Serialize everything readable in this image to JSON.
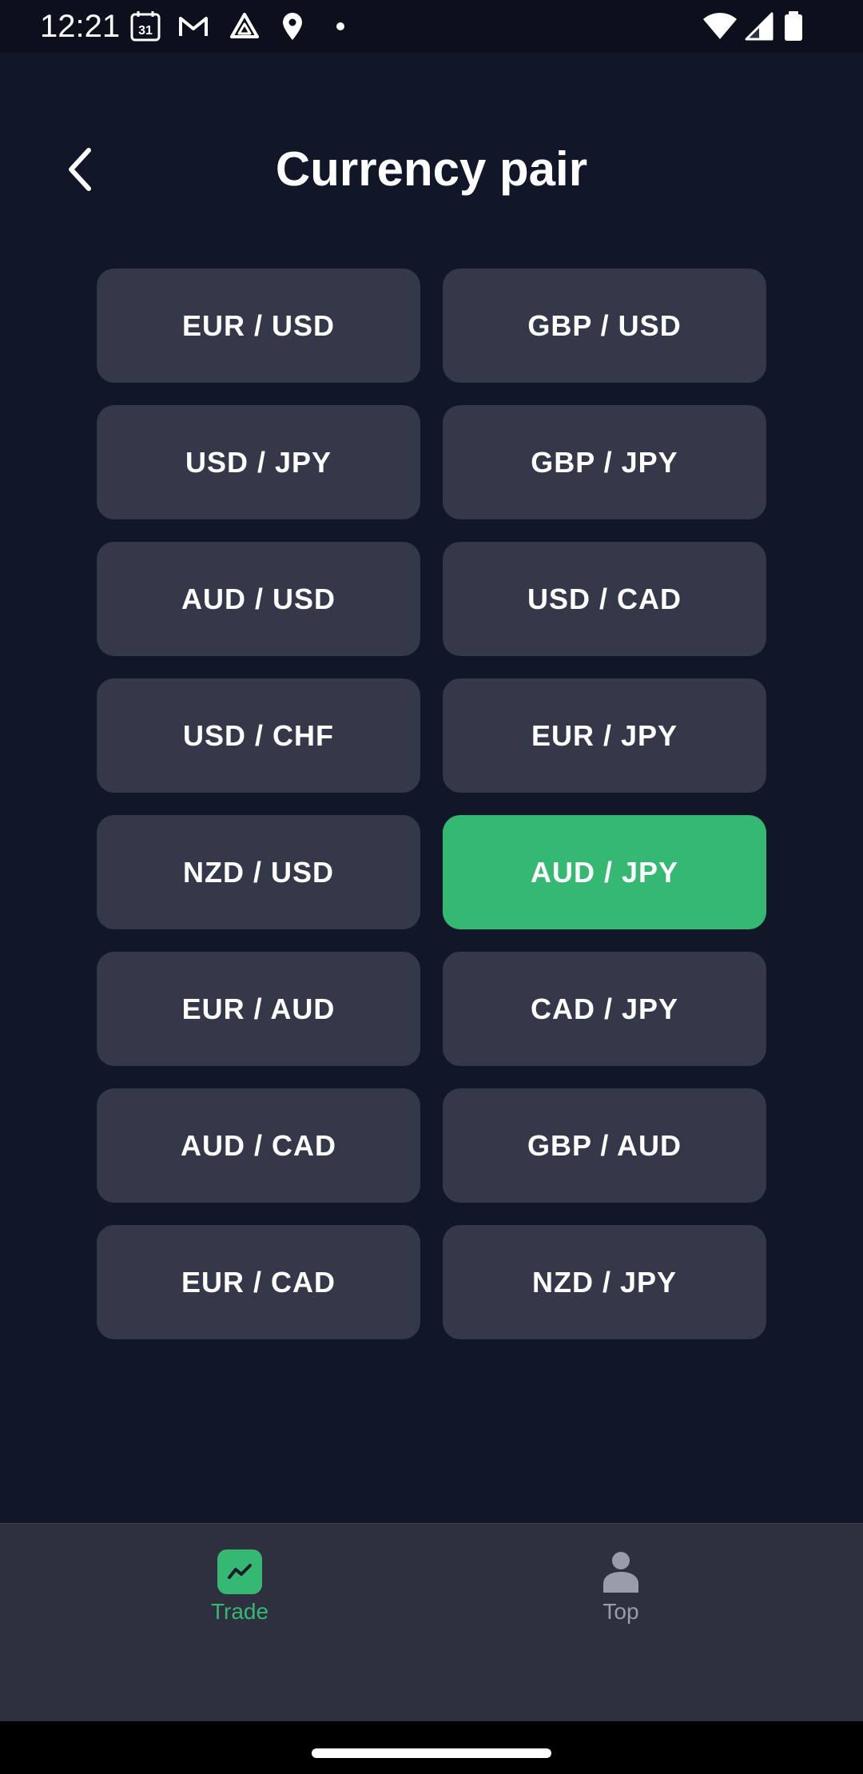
{
  "status_bar": {
    "time": "12:21",
    "calendar_day": "31",
    "left_icons": [
      "calendar-icon",
      "gmail-icon",
      "drive-icon",
      "location-icon",
      "dot-icon"
    ],
    "right_icons": [
      "wifi-icon",
      "signal-icon",
      "battery-icon"
    ]
  },
  "header": {
    "title": "Currency pair",
    "back_icon": "chevron-left-icon"
  },
  "pairs": [
    {
      "label": "EUR / USD",
      "selected": false
    },
    {
      "label": "GBP / USD",
      "selected": false
    },
    {
      "label": "USD / JPY",
      "selected": false
    },
    {
      "label": "GBP / JPY",
      "selected": false
    },
    {
      "label": "AUD / USD",
      "selected": false
    },
    {
      "label": "USD / CAD",
      "selected": false
    },
    {
      "label": "USD / CHF",
      "selected": false
    },
    {
      "label": "EUR / JPY",
      "selected": false
    },
    {
      "label": "NZD / USD",
      "selected": false
    },
    {
      "label": "AUD / JPY",
      "selected": true
    },
    {
      "label": "EUR / AUD",
      "selected": false
    },
    {
      "label": "CAD / JPY",
      "selected": false
    },
    {
      "label": "AUD / CAD",
      "selected": false
    },
    {
      "label": "GBP / AUD",
      "selected": false
    },
    {
      "label": "EUR / CAD",
      "selected": false
    },
    {
      "label": "NZD / JPY",
      "selected": false
    }
  ],
  "bottom_nav": {
    "items": [
      {
        "label": "Trade",
        "icon": "trend-chart-icon",
        "active": true
      },
      {
        "label": "Top",
        "icon": "person-icon",
        "active": false
      }
    ]
  },
  "colors": {
    "background": "#111628",
    "button": "#353849",
    "accent": "#35b872",
    "nav_background": "#2e3040",
    "nav_inactive": "#9a9cab"
  }
}
